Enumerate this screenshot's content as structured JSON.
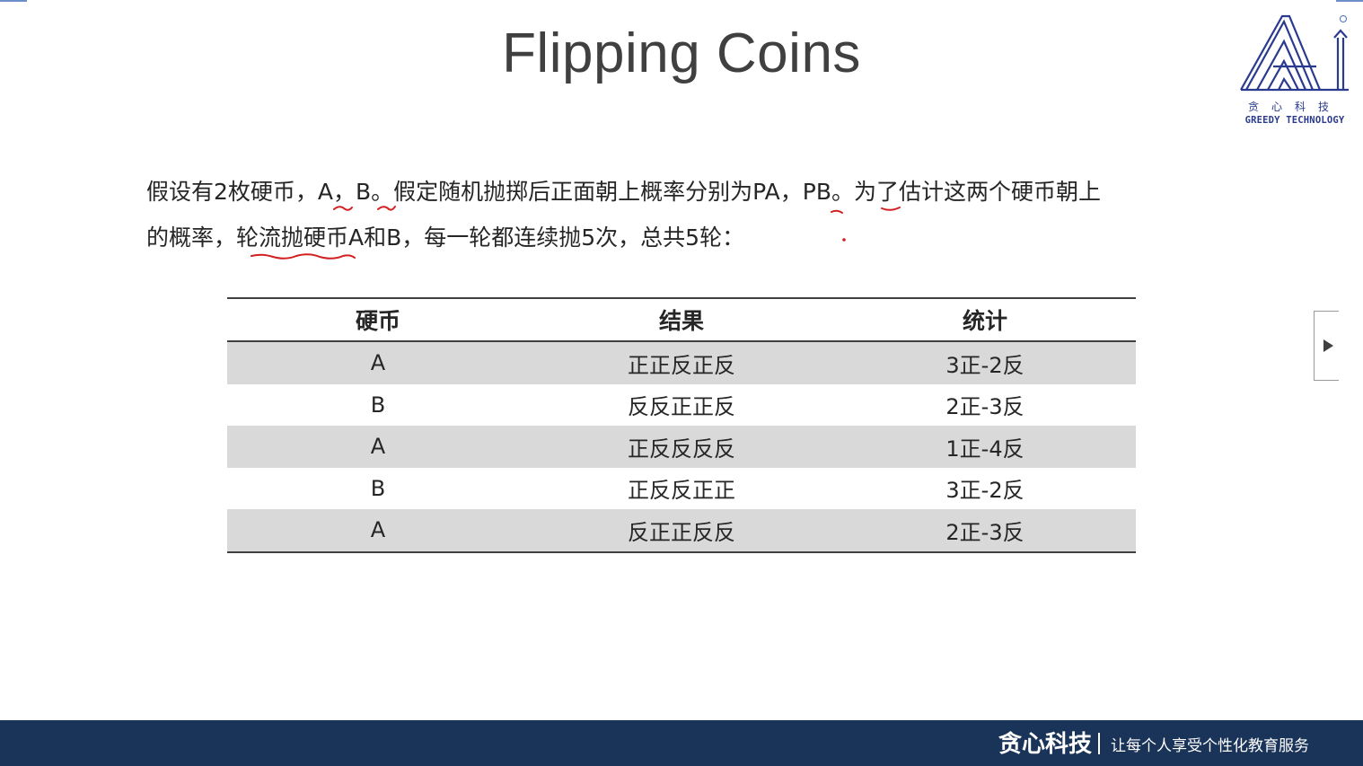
{
  "slide": {
    "title": "Flipping Coins",
    "logo": {
      "cn_text": "贪心科技",
      "en_text": "GREEDY TECHNOLOGY",
      "color": "#2a3b8f"
    },
    "paragraph": {
      "line1": "假设有2枚硬币，A，B。假定随机抛掷后正面朝上概率分别为PA，PB。为了估计这两个硬币朝上",
      "line2": "的概率，轮流抛硬币A和B，每一轮都连续抛5次，总共5轮："
    },
    "table": {
      "headers": [
        "硬币",
        "结果",
        "统计"
      ],
      "rows": [
        [
          "A",
          "正正反正反",
          "3正-2反"
        ],
        [
          "B",
          "反反正正反",
          "2正-3反"
        ],
        [
          "A",
          "正反反反反",
          "1正-4反"
        ],
        [
          "B",
          "正反反正正",
          "3正-2反"
        ],
        [
          "A",
          "反正正反反",
          "2正-3反"
        ]
      ],
      "shade_color": "#d9d9d9"
    }
  },
  "footer": {
    "brand": "贪心科技",
    "slogan": "让每个人享受个性化教育服务",
    "background": "#1a3358"
  },
  "side_nav": {
    "icon": "play-triangle-icon"
  },
  "annotation_color": "#d21f1f"
}
